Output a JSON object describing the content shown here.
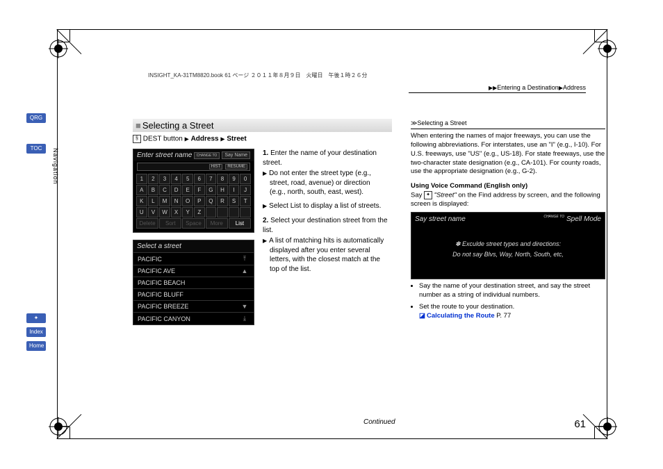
{
  "bookline": "INSIGHT_KA-31TM8820.book  61 ページ  ２０１１年８月９日　火曜日　午後１時２６分",
  "breadcrumb": {
    "a": "Entering a Destination",
    "b": "Address"
  },
  "tabs": {
    "qrg": "QRG",
    "toc": "TOC",
    "voice": "✦",
    "index": "Index",
    "home": "Home"
  },
  "vnav": "Navigation",
  "section_title": "Selecting a Street",
  "path": {
    "pre": "DEST button",
    "a": "Address",
    "b": "Street"
  },
  "screen1": {
    "title": "Enter street name",
    "change_to": "CHANGE TO",
    "btn": "Say Name",
    "mini1": "HIST",
    "mini2": "RESUME",
    "rows": [
      [
        "1",
        "2",
        "3",
        "4",
        "5",
        "6",
        "7",
        "8",
        "9",
        "0"
      ],
      [
        "A",
        "B",
        "C",
        "D",
        "E",
        "F",
        "G",
        "H",
        "I",
        "J"
      ],
      [
        "K",
        "L",
        "M",
        "N",
        "O",
        "P",
        "Q",
        "R",
        "S",
        "T"
      ],
      [
        "U",
        "V",
        "W",
        "X",
        "Y",
        "Z",
        "",
        "",
        "",
        ""
      ]
    ],
    "bottom": [
      "Delete",
      "Sort",
      "Space",
      "More",
      "List"
    ]
  },
  "screen2": {
    "title": "Select a street",
    "items": [
      "PACIFIC",
      "PACIFIC AVE",
      "PACIFIC BEACH",
      "PACIFIC BLUFF",
      "PACIFIC BREEZE",
      "PACIFIC CANYON"
    ]
  },
  "steps": {
    "s1": "Enter the name of your destination street.",
    "s1a": "Do not enter the street type (e.g., street, road, avenue) or direction (e.g., north, south, east, west).",
    "s1b_pre": "Select ",
    "s1b_em": "List",
    "s1b_post": " to display a list of streets.",
    "s2": "Select your destination street from the list.",
    "s2a": "A list of matching hits is automatically displayed after you enter several letters, with the closest match at the top of the list."
  },
  "right": {
    "title": "Selecting a Street",
    "p1": "When entering the names of major freeways, you can use the following abbreviations. For interstates, use an \"I\" (e.g., I-10). For U.S. freeways, use \"US\" (e.g., US-18). For state freeways, use the two-character state designation (e.g., CA-101). For county roads, use the appropriate designation (e.g., G-2).",
    "sub": "Using Voice Command (English only)",
    "p2a": "Say ",
    "p2b": "\"Street\"",
    "p2c": " on the Find address by screen, and the following screen is displayed:",
    "vscreen": {
      "title": "Say street name",
      "change_to": "CHANGE TO",
      "btn": "Spell Mode",
      "l1": "✽ Exculde street types and directions:",
      "l2": "Do not say Blvs, Way, North, South, etc,"
    },
    "b1": "Say the name of your destination street, and say the street number as a string of individual numbers.",
    "b2": "Set the route to your destination.",
    "link": "Calculating the Route",
    "linkpage": "P. 77"
  },
  "continued": "Continued",
  "pagenum": "61"
}
